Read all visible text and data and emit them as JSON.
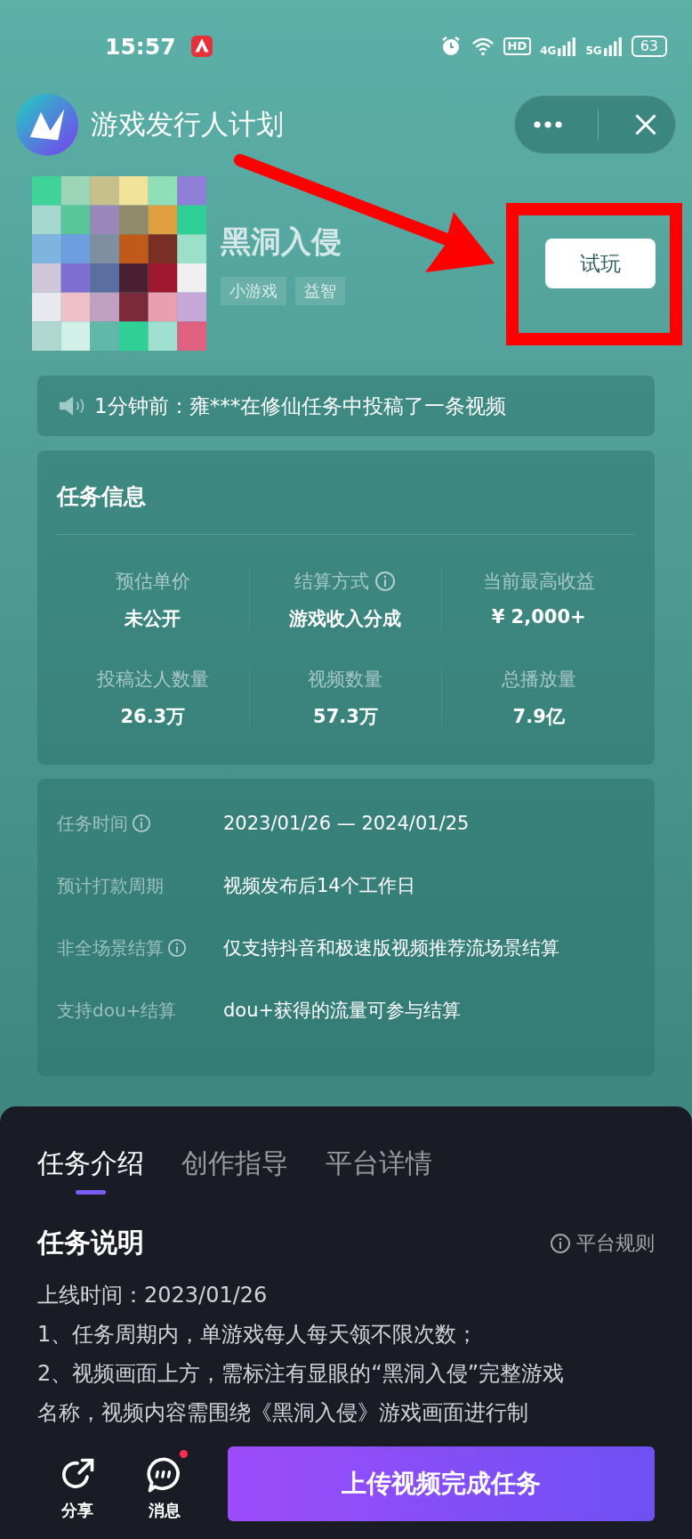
{
  "status_bar": {
    "time": "15:57",
    "network_labels": [
      "HD",
      "4G",
      "5G"
    ],
    "battery": "63"
  },
  "header": {
    "title": "游戏发行人计划"
  },
  "game": {
    "name": "黑洞入侵",
    "tags": [
      "小游戏",
      "益智"
    ],
    "try_button": "试玩"
  },
  "notice": "1分钟前：雍***在修仙任务中投稿了一条视频",
  "task_info": {
    "title": "任务信息",
    "stats": [
      {
        "label": "预估单价",
        "value": "未公开",
        "info": false
      },
      {
        "label": "结算方式",
        "value": "游戏收入分成",
        "info": true
      },
      {
        "label": "当前最高收益",
        "value": "¥ 2,000+",
        "info": false
      },
      {
        "label": "投稿达人数量",
        "value": "26.3万",
        "info": false
      },
      {
        "label": "视频数量",
        "value": "57.3万",
        "info": false
      },
      {
        "label": "总播放量",
        "value": "7.9亿",
        "info": false
      }
    ]
  },
  "details": [
    {
      "label": "任务时间",
      "info": true,
      "value": "2023/01/26 — 2024/01/25"
    },
    {
      "label": "预计打款周期",
      "info": false,
      "value": "视频发布后14个工作日"
    },
    {
      "label": "非全场景结算",
      "info": true,
      "value": "仅支持抖音和极速版视频推荐流场景结算"
    },
    {
      "label": "支持dou+结算",
      "info": false,
      "value": "dou+获得的流量可参与结算"
    }
  ],
  "tabs": [
    {
      "label": "任务介绍",
      "selected": true
    },
    {
      "label": "创作指导",
      "selected": false
    },
    {
      "label": "平台详情",
      "selected": false
    }
  ],
  "section": {
    "title": "任务说明",
    "rules_link": "平台规则"
  },
  "description": [
    "上线时间：2023/01/26",
    "1、任务周期内，单游戏每人每天领不限次数；",
    "2、视频画面上方，需标注有显眼的“黑洞入侵”完整游戏",
    "名称，视频内容需围绕《黑洞入侵》游戏画面进行制"
  ],
  "actions": [
    {
      "label": "分享",
      "kind": "share",
      "badge": false
    },
    {
      "label": "消息",
      "kind": "message",
      "badge": true
    }
  ],
  "submit_button": "上传视频完成任务"
}
